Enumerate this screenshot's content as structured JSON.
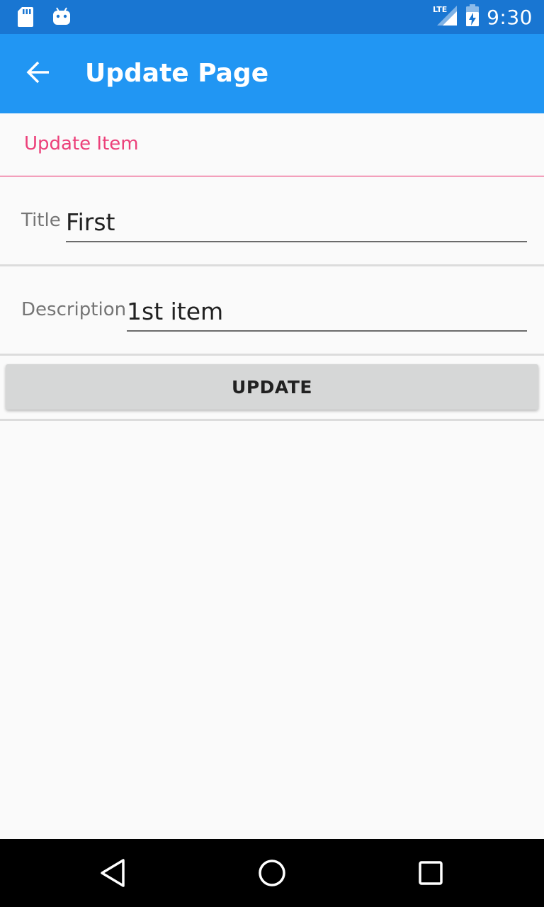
{
  "status_bar": {
    "time": "9:30",
    "network": "LTE",
    "icons": [
      "sd-card-icon",
      "android-icon",
      "lte-signal-icon",
      "battery-icon"
    ]
  },
  "app_bar": {
    "title": "Update Page",
    "back_icon": "arrow-back-icon",
    "color": "#2196f3"
  },
  "section": {
    "title": "Update Item",
    "accent": "#ec407a"
  },
  "form": {
    "title_label": "Title",
    "title_value": "First",
    "description_label": "Description",
    "description_value": "1st item"
  },
  "button": {
    "label": "UPDATE"
  },
  "nav_bar": {
    "icons": [
      "nav-back-icon",
      "nav-home-icon",
      "nav-recents-icon"
    ]
  }
}
